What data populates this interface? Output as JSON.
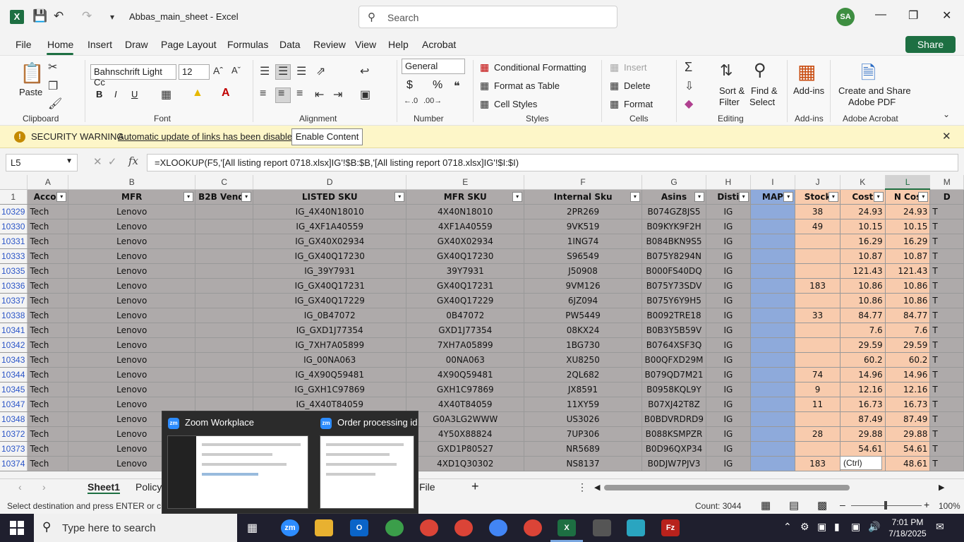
{
  "titlebar": {
    "doc_title": "Abbas_main_sheet  -  Excel",
    "search_placeholder": "Search",
    "avatar_initials": "SA"
  },
  "menu": {
    "tabs": [
      "File",
      "Home",
      "Insert",
      "Draw",
      "Page Layout",
      "Formulas",
      "Data",
      "Review",
      "View",
      "Help",
      "Acrobat"
    ],
    "share_label": "Share"
  },
  "ribbon": {
    "clipboard": {
      "paste": "Paste",
      "label": "Clipboard"
    },
    "font": {
      "name": "Bahnschrift Light Cc",
      "size": "12",
      "label": "Font",
      "bold": "B",
      "italic": "I",
      "underline": "U"
    },
    "alignment": {
      "label": "Alignment"
    },
    "number": {
      "format": "General",
      "label": "Number",
      "currency": "$",
      "percent": "%"
    },
    "styles": {
      "conditional": "Conditional Formatting",
      "table": "Format as Table",
      "cell": "Cell Styles",
      "label": "Styles"
    },
    "cells": {
      "insert": "Insert",
      "delete": "Delete",
      "format": "Format",
      "label": "Cells"
    },
    "editing": {
      "sort": "Sort &",
      "filter": "Filter",
      "find": "Find &",
      "select": "Select",
      "label": "Editing"
    },
    "addins": {
      "btn": "Add-ins",
      "label": "Add-ins"
    },
    "acrobat": {
      "line1": "Create and Share",
      "line2": "Adobe PDF",
      "label": "Adobe Acrobat"
    }
  },
  "security": {
    "title": "SECURITY WARNING",
    "message": "Automatic update of links has been disabled",
    "button": "Enable Content"
  },
  "formula_bar": {
    "namebox": "L5",
    "formula": "=XLOOKUP(F5,'[All listing report 0718.xlsx]IG'!$B:$B,'[All listing report 0718.xlsx]IG'!$I:$I)"
  },
  "grid": {
    "columns": [
      "A",
      "B",
      "C",
      "D",
      "E",
      "F",
      "G",
      "H",
      "I",
      "J",
      "K",
      "L",
      "M"
    ],
    "header_row_num": "1",
    "headers": [
      "Accou",
      "MFR",
      "B2B Vendo",
      "LISTED SKU",
      "MFR SKU",
      "Internal Sku",
      "Asins",
      "Disti",
      "MAP",
      "Stock",
      "Cost",
      "N Cos",
      "D"
    ],
    "rows": [
      {
        "n": "10329",
        "a": "Tech",
        "b": "Lenovo",
        "d": "IG_4X40N18010",
        "e": "4X40N18010",
        "f": "2PR269",
        "g": "B074GZ8JS5",
        "h": "IG",
        "j": "38",
        "k": "24.93",
        "l": "24.93",
        "m": "T"
      },
      {
        "n": "10330",
        "a": "Tech",
        "b": "Lenovo",
        "d": "IG_4XF1A40559",
        "e": "4XF1A40559",
        "f": "9VK519",
        "g": "B09KYK9F2H",
        "h": "IG",
        "j": "49",
        "k": "10.15",
        "l": "10.15",
        "m": "T"
      },
      {
        "n": "10331",
        "a": "Tech",
        "b": "Lenovo",
        "d": "IG_GX40X02934",
        "e": "GX40X02934",
        "f": "1ING74",
        "g": "B084BKN9S5",
        "h": "IG",
        "j": "",
        "k": "16.29",
        "l": "16.29",
        "m": "T"
      },
      {
        "n": "10333",
        "a": "Tech",
        "b": "Lenovo",
        "d": "IG_GX40Q17230",
        "e": "GX40Q17230",
        "f": "S96549",
        "g": "B075Y8294N",
        "h": "IG",
        "j": "",
        "k": "10.87",
        "l": "10.87",
        "m": "T"
      },
      {
        "n": "10335",
        "a": "Tech",
        "b": "Lenovo",
        "d": "IG_39Y7931",
        "e": "39Y7931",
        "f": "J50908",
        "g": "B000FS40DQ",
        "h": "IG",
        "j": "",
        "k": "121.43",
        "l": "121.43",
        "m": "T"
      },
      {
        "n": "10336",
        "a": "Tech",
        "b": "Lenovo",
        "d": "IG_GX40Q17231",
        "e": "GX40Q17231",
        "f": "9VM126",
        "g": "B075Y73SDV",
        "h": "IG",
        "j": "183",
        "k": "10.86",
        "l": "10.86",
        "m": "T"
      },
      {
        "n": "10337",
        "a": "Tech",
        "b": "Lenovo",
        "d": "IG_GX40Q17229",
        "e": "GX40Q17229",
        "f": "6JZ094",
        "g": "B075Y6Y9H5",
        "h": "IG",
        "j": "",
        "k": "10.86",
        "l": "10.86",
        "m": "T"
      },
      {
        "n": "10338",
        "a": "Tech",
        "b": "Lenovo",
        "d": "IG_0B47072",
        "e": "0B47072",
        "f": "PW5449",
        "g": "B0092TRE18",
        "h": "IG",
        "j": "33",
        "k": "84.77",
        "l": "84.77",
        "m": "T"
      },
      {
        "n": "10341",
        "a": "Tech",
        "b": "Lenovo",
        "d": "IG_GXD1J77354",
        "e": "GXD1J77354",
        "f": "08KX24",
        "g": "B0B3Y5B59V",
        "h": "IG",
        "j": "",
        "k": "7.6",
        "l": "7.6",
        "m": "T"
      },
      {
        "n": "10342",
        "a": "Tech",
        "b": "Lenovo",
        "d": "IG_7XH7A05899",
        "e": "7XH7A05899",
        "f": "1BG730",
        "g": "B0764XSF3Q",
        "h": "IG",
        "j": "",
        "k": "29.59",
        "l": "29.59",
        "m": "T"
      },
      {
        "n": "10343",
        "a": "Tech",
        "b": "Lenovo",
        "d": "IG_00NA063",
        "e": "00NA063",
        "f": "XU8250",
        "g": "B00QFXD29M",
        "h": "IG",
        "j": "",
        "k": "60.2",
        "l": "60.2",
        "m": "T"
      },
      {
        "n": "10344",
        "a": "Tech",
        "b": "Lenovo",
        "d": "IG_4X90Q59481",
        "e": "4X90Q59481",
        "f": "2QL682",
        "g": "B079QD7M21",
        "h": "IG",
        "j": "74",
        "k": "14.96",
        "l": "14.96",
        "m": "T"
      },
      {
        "n": "10345",
        "a": "Tech",
        "b": "Lenovo",
        "d": "IG_GXH1C97869",
        "e": "GXH1C97869",
        "f": "JX8591",
        "g": "B0958KQL9Y",
        "h": "IG",
        "j": "9",
        "k": "12.16",
        "l": "12.16",
        "m": "T"
      },
      {
        "n": "10347",
        "a": "Tech",
        "b": "Lenovo",
        "d": "IG_4X40T84059",
        "e": "4X40T84059",
        "f": "11XY59",
        "g": "B07XJ42T8Z",
        "h": "IG",
        "j": "11",
        "k": "16.73",
        "l": "16.73",
        "m": "T"
      },
      {
        "n": "10348",
        "a": "Tech",
        "b": "Lenovo",
        "d": "",
        "e": "G0A3LG2WWW",
        "f": "US3026",
        "g": "B0BDVRDRD9",
        "h": "IG",
        "j": "",
        "k": "87.49",
        "l": "87.49",
        "m": "T"
      },
      {
        "n": "10372",
        "a": "Tech",
        "b": "Lenovo",
        "d": "",
        "e": "4Y50X88824",
        "f": "7UP306",
        "g": "B088KSMPZR",
        "h": "IG",
        "j": "28",
        "k": "29.88",
        "l": "29.88",
        "m": "T"
      },
      {
        "n": "10373",
        "a": "Tech",
        "b": "Lenovo",
        "d": "",
        "e": "GXD1P80527",
        "f": "NR5689",
        "g": "B0D96QXP34",
        "h": "IG",
        "j": "",
        "k": "54.61",
        "l": "54.61",
        "m": "T"
      },
      {
        "n": "10374",
        "a": "Tech",
        "b": "Lenovo",
        "d": "",
        "e": "4XD1Q30302",
        "f": "NS8137",
        "g": "B0DJW7PJV3",
        "h": "IG",
        "j": "183",
        "k": "",
        "l": "48.61",
        "m": "T"
      }
    ]
  },
  "sheets": {
    "tab1": "Sheet1",
    "tab2": "Policy",
    "tab3": "File"
  },
  "status": {
    "message": "Select destination and press ENTER or cho",
    "count": "Count: 3044",
    "zoom": "100%"
  },
  "preview": {
    "win1": "Zoom Workplace",
    "win2": "Order processing id",
    "app_badge": "zm"
  },
  "ctrl_tip": "(Ctrl)",
  "taskbar": {
    "search_placeholder": "Type here to search",
    "time": "7:01 PM",
    "date": "7/18/2025"
  },
  "colors": {
    "excel_green": "#1d6f42",
    "header_gray": "#aeaaaa",
    "map_blue": "#8eaadb",
    "stock_peach": "#f8cbad",
    "security_yellow": "#fdf6c8"
  }
}
